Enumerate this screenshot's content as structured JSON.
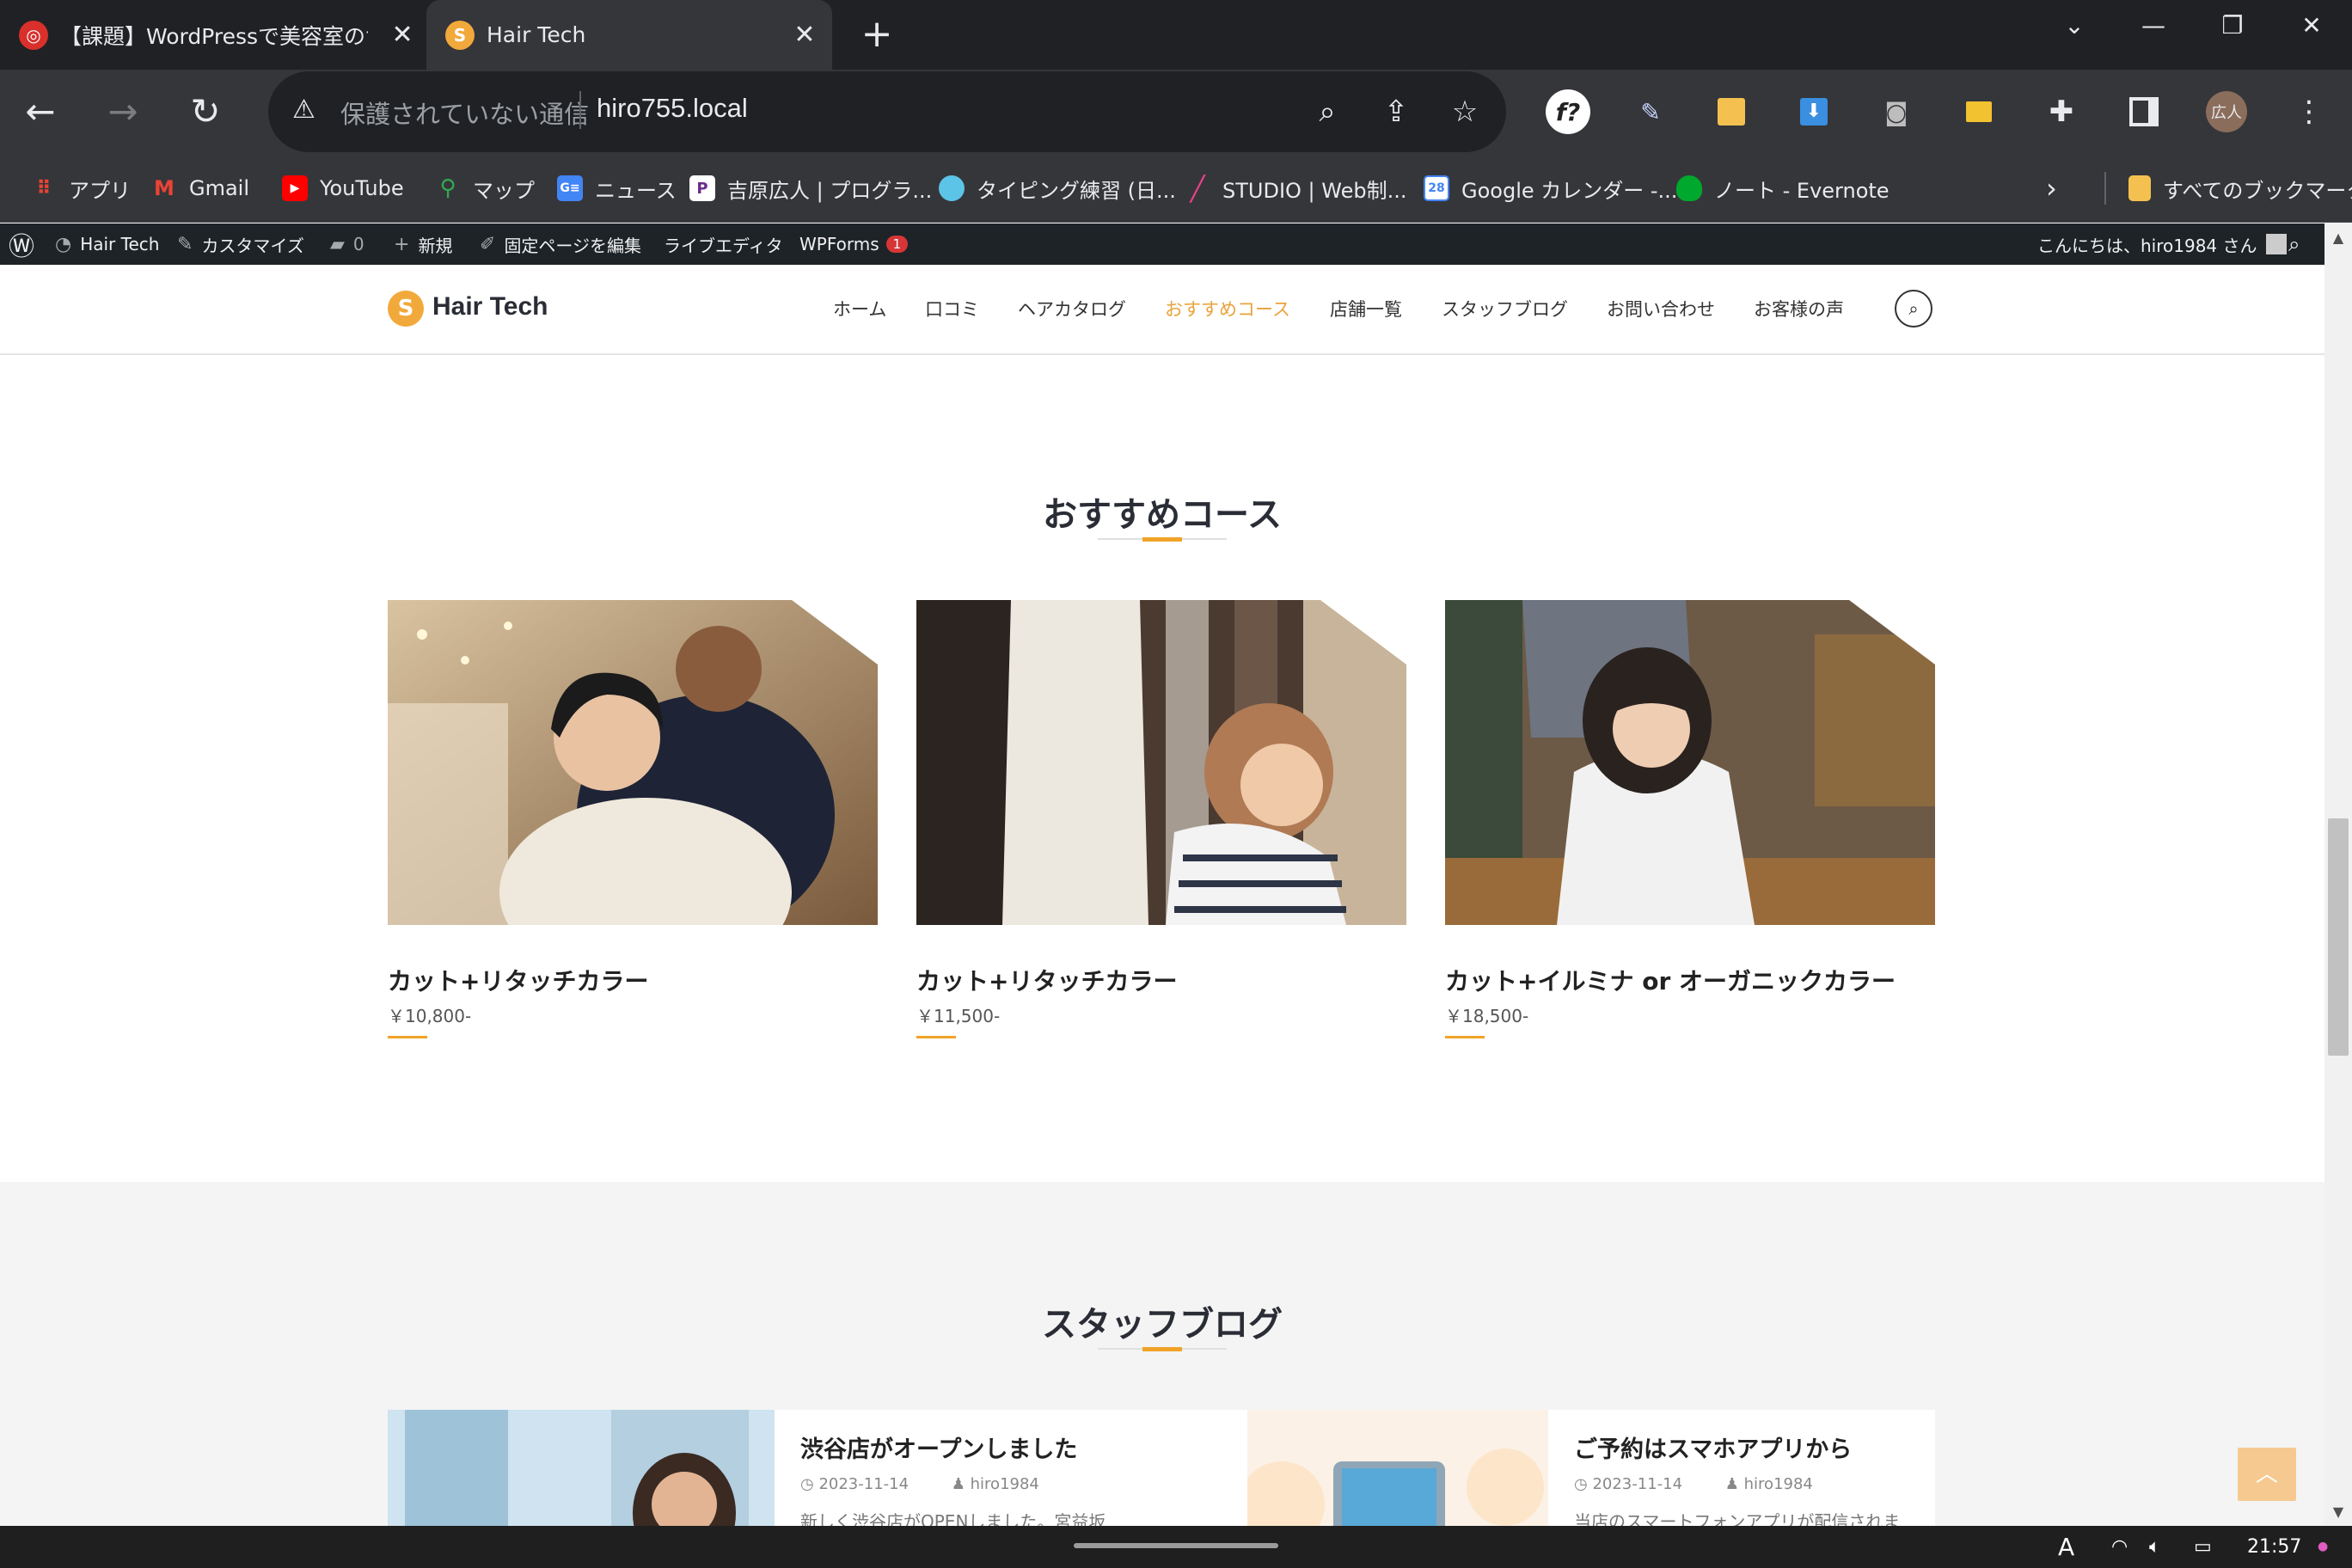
{
  "browser": {
    "tabs": [
      {
        "title": "【課題】WordPressで美容室のサ",
        "close": "✕"
      },
      {
        "title": "Hair Tech",
        "close": "✕"
      }
    ],
    "new_tab": "+",
    "window_controls": {
      "minimize": "—",
      "restore": "❐",
      "close": "✕",
      "dropdown": "⌄"
    },
    "omnibox": {
      "security_label": "保護されていない通信",
      "url": "hiro755.local"
    },
    "profile_label": "広人",
    "bookmarks": [
      {
        "label": "アプリ",
        "icon": "apps-grid-icon"
      },
      {
        "label": "Gmail",
        "icon": "gmail-icon"
      },
      {
        "label": "YouTube",
        "icon": "youtube-icon"
      },
      {
        "label": "マップ",
        "icon": "maps-icon"
      },
      {
        "label": "ニュース",
        "icon": "news-icon"
      },
      {
        "label": "吉原広人 | プログラ...",
        "icon": "p-icon"
      },
      {
        "label": "タイピング練習 (日...",
        "icon": "typing-icon"
      },
      {
        "label": "STUDIO | Web制...",
        "icon": "studio-icon"
      },
      {
        "label": "Google カレンダー -...",
        "icon": "calendar-icon"
      },
      {
        "label": "ノート - Evernote",
        "icon": "evernote-icon"
      }
    ],
    "all_bookmarks": "すべてのブックマーク"
  },
  "admin_bar": {
    "site_name": "Hair Tech",
    "customize": "カスタマイズ",
    "comments_count": "0",
    "new": "新規",
    "edit_page": "固定ページを編集",
    "live_editor": "ライブエディタ",
    "wpforms": "WPForms",
    "wpforms_badge": "1",
    "greeting": "こんにちは、hiro1984 さん"
  },
  "site": {
    "logo_mark": "S",
    "logo_text": "Hair Tech",
    "nav": [
      "ホーム",
      "口コミ",
      "ヘアカタログ",
      "おすすめコース",
      "店舗一覧",
      "スタッフブログ",
      "お問い合わせ",
      "お客様の声"
    ],
    "nav_active_index": 3
  },
  "courses": {
    "title": "おすすめコース",
    "items": [
      {
        "name": "カット+リタッチカラー",
        "price": "￥10,800-"
      },
      {
        "name": "カット+リタッチカラー",
        "price": "￥11,500-"
      },
      {
        "name": "カット+イルミナ or オーガニックカラー",
        "price": "￥18,500-"
      }
    ]
  },
  "blog": {
    "title": "スタッフブログ",
    "posts": [
      {
        "title": "渋谷店がオープンしました",
        "date": "2023-11-14",
        "author": "hiro1984",
        "excerpt": "新しく渋谷店がOPENしました。宮益坂"
      },
      {
        "title": "ご予約はスマホアプリから",
        "date": "2023-11-14",
        "author": "hiro1984",
        "excerpt": "当店のスマートフォンアプリが配信されま"
      }
    ]
  },
  "back_to_top": "︿",
  "taskbar": {
    "time": "21:57",
    "ime": "A"
  },
  "colors": {
    "accent": "#f0a328",
    "browser_dark": "#202124",
    "admin_bar": "#1d2327"
  }
}
